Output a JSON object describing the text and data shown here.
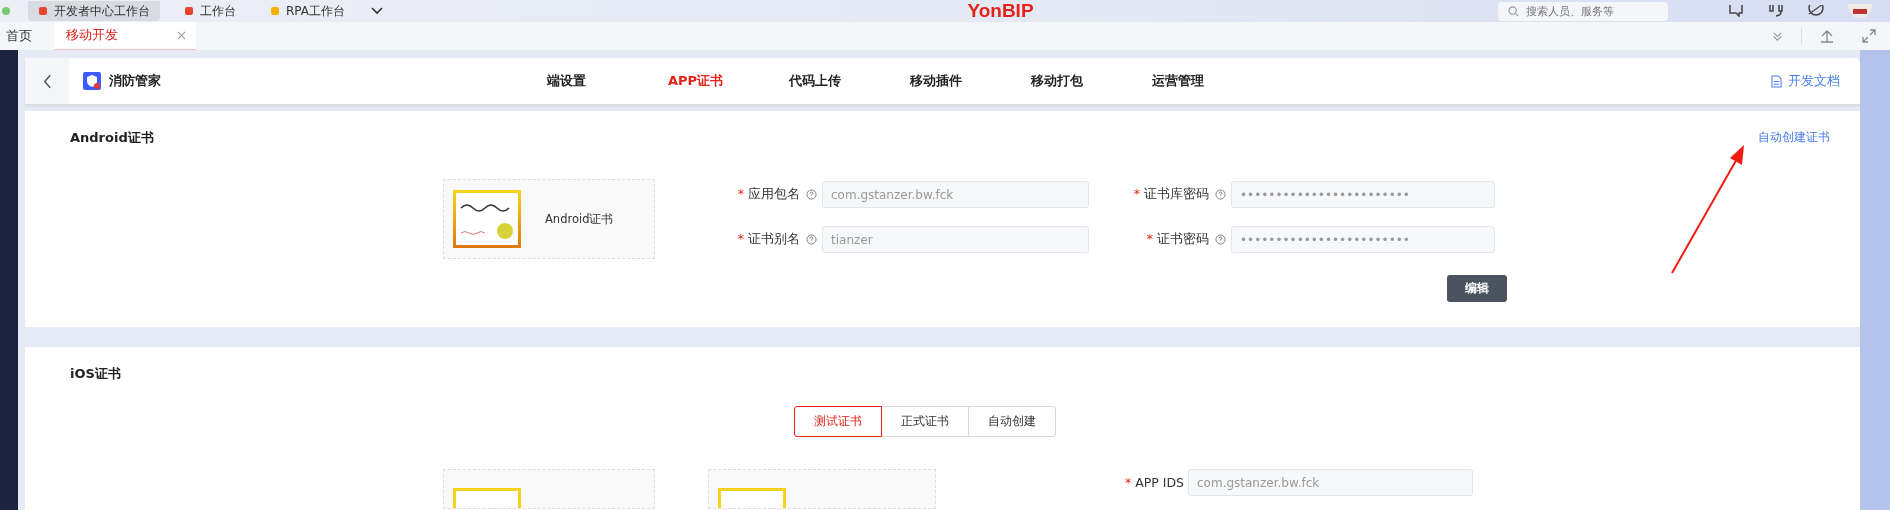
{
  "browser_tabs": [
    {
      "label": "开发者中心工作台",
      "selected": true
    },
    {
      "label": "工作台",
      "selected": false
    },
    {
      "label": "RPA工作台",
      "selected": false
    }
  ],
  "brand": "YonBIP",
  "search": {
    "placeholder": "搜索人员、服务等"
  },
  "page_tabs": [
    {
      "label": "首页",
      "selected": false,
      "closable": false
    },
    {
      "label": "移动开发",
      "selected": true,
      "closable": true
    }
  ],
  "app": {
    "name": "消防管家"
  },
  "nav": [
    {
      "label": "端设置",
      "selected": false
    },
    {
      "label": "APP证书",
      "selected": true
    },
    {
      "label": "代码上传",
      "selected": false
    },
    {
      "label": "移动插件",
      "selected": false
    },
    {
      "label": "移动打包",
      "selected": false
    },
    {
      "label": "运营管理",
      "selected": false
    }
  ],
  "docs_link": "开发文档",
  "android": {
    "title": "Android证书",
    "auto_link": "自动创建证书",
    "cert_label": "Android证书",
    "fields": [
      {
        "label": "应用包名",
        "marker": "*",
        "value": "com.gstanzer.bw.fck"
      },
      {
        "label": "证书库密码",
        "marker": "*",
        "value": "••••••••••••••••••••••••"
      },
      {
        "label": "证书别名",
        "marker": "*",
        "value": "tianzer"
      },
      {
        "label": "证书密码",
        "marker": "*",
        "value": "••••••••••••••••••••••••"
      }
    ],
    "edit_button": "编辑"
  },
  "ios": {
    "title": "iOS证书",
    "segments": [
      {
        "label": "测试证书",
        "selected": true
      },
      {
        "label": "正式证书",
        "selected": false
      },
      {
        "label": "自动创建",
        "selected": false
      }
    ],
    "fields": [
      {
        "label": "APP IDS",
        "marker": "*",
        "value": "com.gstanzer.bw.fck"
      }
    ]
  }
}
